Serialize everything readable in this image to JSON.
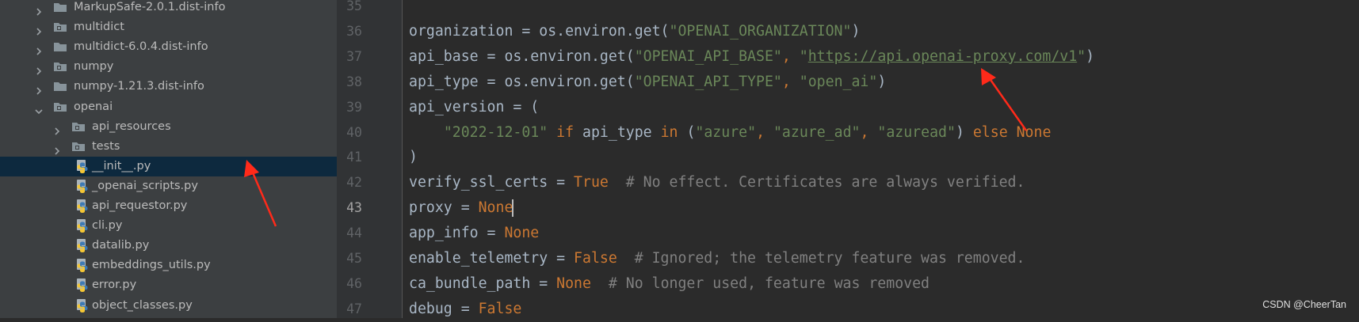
{
  "project_tree": {
    "items": [
      {
        "label": "MarkupSafe-2.0.1.dist-info",
        "kind": "folder",
        "expanded": false,
        "depth": 0
      },
      {
        "label": "multidict",
        "kind": "package",
        "expanded": false,
        "depth": 0
      },
      {
        "label": "multidict-6.0.4.dist-info",
        "kind": "folder",
        "expanded": false,
        "depth": 0
      },
      {
        "label": "numpy",
        "kind": "package",
        "expanded": false,
        "depth": 0
      },
      {
        "label": "numpy-1.21.3.dist-info",
        "kind": "folder",
        "expanded": false,
        "depth": 0
      },
      {
        "label": "openai",
        "kind": "package",
        "expanded": true,
        "depth": 0
      },
      {
        "label": "api_resources",
        "kind": "package",
        "expanded": false,
        "depth": 1
      },
      {
        "label": "tests",
        "kind": "package",
        "expanded": false,
        "depth": 1
      },
      {
        "label": "__init__.py",
        "kind": "python-file",
        "selected": true,
        "depth": 1
      },
      {
        "label": "_openai_scripts.py",
        "kind": "python-file",
        "depth": 1
      },
      {
        "label": "api_requestor.py",
        "kind": "python-file",
        "depth": 1
      },
      {
        "label": "cli.py",
        "kind": "python-file",
        "depth": 1
      },
      {
        "label": "datalib.py",
        "kind": "python-file",
        "depth": 1
      },
      {
        "label": "embeddings_utils.py",
        "kind": "python-file",
        "depth": 1
      },
      {
        "label": "error.py",
        "kind": "python-file",
        "depth": 1
      },
      {
        "label": "object_classes.py",
        "kind": "python-file",
        "depth": 1
      }
    ]
  },
  "editor": {
    "current_line": "43",
    "lines": [
      {
        "number": "35",
        "tokens": []
      },
      {
        "number": "36",
        "tokens": [
          {
            "t": "organization = os.environ.get(",
            "c": "plain"
          },
          {
            "t": "\"OPENAI_ORGANIZATION\"",
            "c": "str"
          },
          {
            "t": ")",
            "c": "plain"
          }
        ]
      },
      {
        "number": "37",
        "tokens": [
          {
            "t": "api_base = os.environ.get(",
            "c": "plain"
          },
          {
            "t": "\"OPENAI_API_BASE\"",
            "c": "str"
          },
          {
            "t": ", ",
            "c": "kw"
          },
          {
            "t": "\"",
            "c": "str"
          },
          {
            "t": "https://api.openai-proxy.com/v1",
            "c": "url"
          },
          {
            "t": "\"",
            "c": "str"
          },
          {
            "t": ")",
            "c": "plain"
          }
        ]
      },
      {
        "number": "38",
        "tokens": [
          {
            "t": "api_type = os.environ.get(",
            "c": "plain"
          },
          {
            "t": "\"OPENAI_API_TYPE\"",
            "c": "str"
          },
          {
            "t": ", ",
            "c": "kw"
          },
          {
            "t": "\"open_ai\"",
            "c": "str"
          },
          {
            "t": ")",
            "c": "plain"
          }
        ]
      },
      {
        "number": "39",
        "tokens": [
          {
            "t": "api_version = (",
            "c": "plain"
          }
        ]
      },
      {
        "number": "40",
        "tokens": [
          {
            "t": "    ",
            "c": "plain"
          },
          {
            "t": "\"2022-12-01\"",
            "c": "str"
          },
          {
            "t": " if ",
            "c": "kw"
          },
          {
            "t": "api_type ",
            "c": "plain"
          },
          {
            "t": "in ",
            "c": "kw"
          },
          {
            "t": "(",
            "c": "plain"
          },
          {
            "t": "\"azure\"",
            "c": "str"
          },
          {
            "t": ", ",
            "c": "kw"
          },
          {
            "t": "\"azure_ad\"",
            "c": "str"
          },
          {
            "t": ", ",
            "c": "kw"
          },
          {
            "t": "\"azuread\"",
            "c": "str"
          },
          {
            "t": ") ",
            "c": "plain"
          },
          {
            "t": "else None",
            "c": "kw"
          }
        ]
      },
      {
        "number": "41",
        "tokens": [
          {
            "t": ")",
            "c": "plain"
          }
        ]
      },
      {
        "number": "42",
        "tokens": [
          {
            "t": "verify_ssl_certs = ",
            "c": "plain"
          },
          {
            "t": "True",
            "c": "kw"
          },
          {
            "t": "  # No effect. Certificates are always verified.",
            "c": "cmt"
          }
        ]
      },
      {
        "number": "43",
        "tokens": [
          {
            "t": "proxy = ",
            "c": "plain"
          },
          {
            "t": "None",
            "c": "kw"
          },
          {
            "t": "",
            "c": "caret"
          }
        ]
      },
      {
        "number": "44",
        "tokens": [
          {
            "t": "app_info = ",
            "c": "plain"
          },
          {
            "t": "None",
            "c": "kw"
          }
        ]
      },
      {
        "number": "45",
        "tokens": [
          {
            "t": "enable_telemetry = ",
            "c": "plain"
          },
          {
            "t": "False",
            "c": "kw"
          },
          {
            "t": "  # Ignored; the telemetry feature was removed.",
            "c": "cmt"
          }
        ]
      },
      {
        "number": "46",
        "tokens": [
          {
            "t": "ca_bundle_path = ",
            "c": "plain"
          },
          {
            "t": "None",
            "c": "kw"
          },
          {
            "t": "  # No longer used, feature was removed",
            "c": "cmt"
          }
        ]
      },
      {
        "number": "47",
        "tokens": [
          {
            "t": "debug = ",
            "c": "plain"
          },
          {
            "t": "False",
            "c": "kw"
          }
        ]
      }
    ]
  },
  "watermark": "CSDN @CheerTan",
  "colors": {
    "tree_bg": "#3c3f41",
    "selection": "#0d293e",
    "editor_bg": "#2b2b2b",
    "keyword": "#cc7832",
    "string": "#6a8759",
    "comment": "#808080",
    "annotation_arrow": "#ff2a1a"
  }
}
